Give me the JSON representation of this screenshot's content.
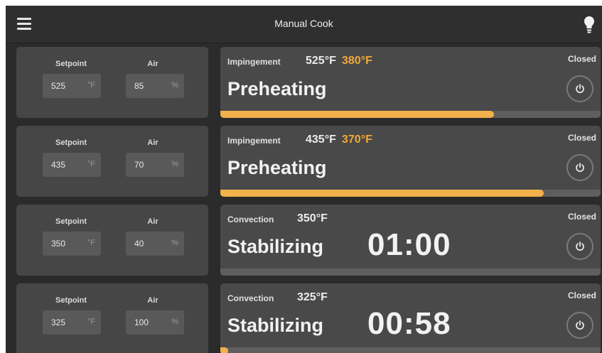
{
  "header": {
    "title": "Manual Cook",
    "menu_icon": "hamburger-menu-icon",
    "light_icon": "lightbulb-icon"
  },
  "colors": {
    "background": "#2b2b2b",
    "panel": "#494949",
    "accent": "#f2b14a",
    "target_temp": "#f2a93b"
  },
  "zones": [
    {
      "setpoint_label": "Setpoint",
      "setpoint_value": "525",
      "setpoint_unit": "°F",
      "air_label": "Air",
      "air_value": "85",
      "air_unit": "%",
      "mode": "Impingement",
      "temp_actual": "525°F",
      "temp_target": "380°F",
      "status": "Preheating",
      "timer": "",
      "door": "Closed",
      "progress": 0.72
    },
    {
      "setpoint_label": "Setpoint",
      "setpoint_value": "435",
      "setpoint_unit": "°F",
      "air_label": "Air",
      "air_value": "70",
      "air_unit": "%",
      "mode": "Impingement",
      "temp_actual": "435°F",
      "temp_target": "370°F",
      "status": "Preheating",
      "timer": "",
      "door": "Closed",
      "progress": 0.85
    },
    {
      "setpoint_label": "Setpoint",
      "setpoint_value": "350",
      "setpoint_unit": "°F",
      "air_label": "Air",
      "air_value": "40",
      "air_unit": "%",
      "mode": "Convection",
      "temp_actual": "350°F",
      "temp_target": "",
      "status": "Stabilizing",
      "timer": "01:00",
      "door": "Closed",
      "progress": 0.0
    },
    {
      "setpoint_label": "Setpoint",
      "setpoint_value": "325",
      "setpoint_unit": "°F",
      "air_label": "Air",
      "air_value": "100",
      "air_unit": "%",
      "mode": "Convection",
      "temp_actual": "325°F",
      "temp_target": "",
      "status": "Stabilizing",
      "timer": "00:58",
      "door": "Closed",
      "progress": 0.02
    }
  ]
}
